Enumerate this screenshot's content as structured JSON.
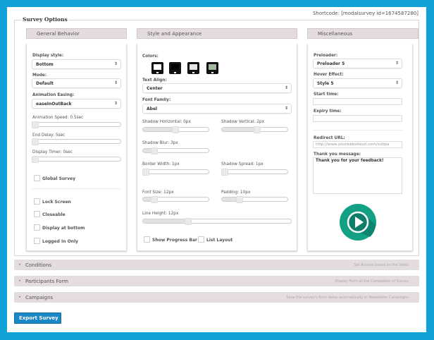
{
  "shortcode": "Shortcode: [modalsurvey id=1674587280]",
  "title": "Survey Options",
  "columns": {
    "general": "General Behavior",
    "style": "Style and Appearance",
    "misc": "Miscellaneous"
  },
  "general": {
    "display_style": {
      "label": "Display style:",
      "value": "Bottom"
    },
    "mode": {
      "label": "Mode:",
      "value": "Default"
    },
    "easing": {
      "label": "Animation Easing:",
      "value": "easeInOutBack"
    },
    "animation_speed": {
      "label": "Animation Speed: 0.5sec",
      "fraction": 0.0
    },
    "end_delay": {
      "label": "End Delay: 5sec",
      "fraction": 0.0
    },
    "display_timer": {
      "label": "Display Timer: 0sec",
      "fraction": 0.0
    },
    "global_survey": "Global Survey",
    "lock_screen": "Lock Screen",
    "closeable": "Closeable",
    "display_bottom": "Display at bottom",
    "logged_in": "Logged In Only"
  },
  "style": {
    "colors_label": "Colors:",
    "colors": [
      "#ffffff",
      "#000000",
      "#e8e4e2",
      "#a3b8a0"
    ],
    "text_align": {
      "label": "Text Align:",
      "value": "Center"
    },
    "font_family": {
      "label": "Font Family:",
      "value": "Abel"
    },
    "shadow_h": {
      "label": "Shadow Horizontal: 0px",
      "fraction": 0.5
    },
    "shadow_v": {
      "label": "Shadow Vertical: 2px",
      "fraction": 0.55
    },
    "shadow_blur": {
      "label": "Shadow Blur: 3px",
      "fraction": 0.15
    },
    "border_width": {
      "label": "Border Width: 1px",
      "fraction": 0.0
    },
    "shadow_spread": {
      "label": "Shadow Spread: 1px",
      "fraction": 0.0
    },
    "font_size": {
      "label": "Font Size: 12px",
      "fraction": 0.15
    },
    "padding": {
      "label": "Padding: 10px",
      "fraction": 0.25
    },
    "line_height": {
      "label": "Line Height: 12px",
      "fraction": 0.3
    },
    "progress_bar": "Show Progress Bar",
    "list_layout": "List Layout"
  },
  "misc": {
    "preloader": {
      "label": "Preloader:",
      "value": "Preloader 5"
    },
    "hover": {
      "label": "Hover Effect:",
      "value": "Style 5"
    },
    "start_label": "Start time:",
    "expiry_label": "Expiry time:",
    "redirect": {
      "label": "Redirect URL:",
      "placeholder": "http://www.yourwebsiteurl.com/subpa"
    },
    "thanks": {
      "label": "Thank you message:",
      "value": "Thank you for your feedback!"
    }
  },
  "accordions": [
    {
      "title": "Conditions",
      "desc": "Set Actions based on the Votes"
    },
    {
      "title": "Participants Form",
      "desc": "Display Form at the Completion of Survey"
    },
    {
      "title": "Campaigns",
      "desc": "Save the survey's form datas automatically to Newsletter Campaigns"
    }
  ],
  "export_label": "Export Survey",
  "accent": "#1b87c6"
}
